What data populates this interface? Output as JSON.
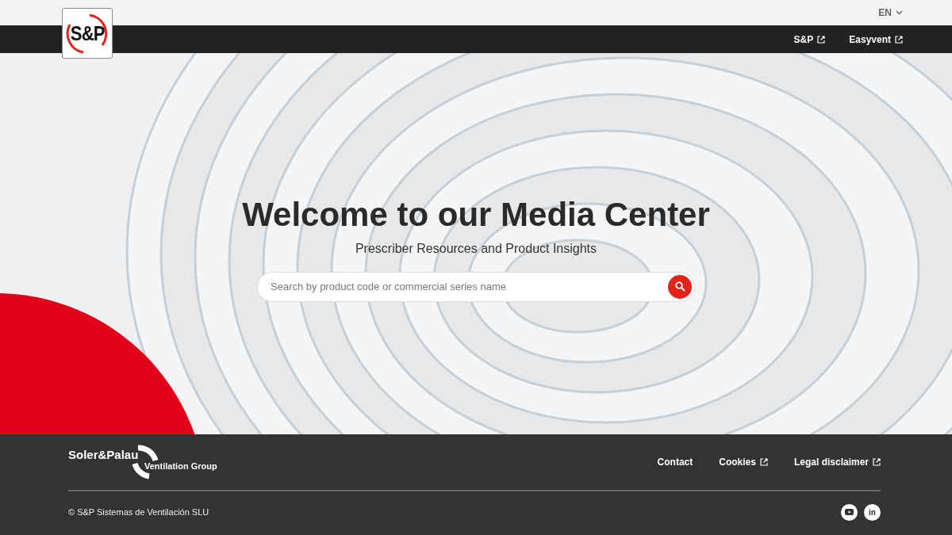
{
  "logo": {
    "text": "S&P"
  },
  "language": {
    "label": "EN"
  },
  "nav_links": [
    {
      "label": "S&P",
      "external": true
    },
    {
      "label": "Easyvent",
      "external": true
    }
  ],
  "hero": {
    "title": "Welcome to our Media Center",
    "subtitle": "Prescriber Resources and Product Insights",
    "search": {
      "placeholder": "Search by product code or commercial series name"
    }
  },
  "footer": {
    "brand": "Soler&Palau",
    "brand_sub": "Ventilation Group",
    "links": [
      {
        "label": "Contact",
        "external": false
      },
      {
        "label": "Cookies",
        "external": true
      },
      {
        "label": "Legal disclaimer",
        "external": true
      }
    ],
    "copyright": "© S&P Sistemas de Ventilación SLU",
    "social": [
      {
        "kind": "youtube"
      },
      {
        "kind": "linkedin",
        "text": "in"
      }
    ]
  }
}
